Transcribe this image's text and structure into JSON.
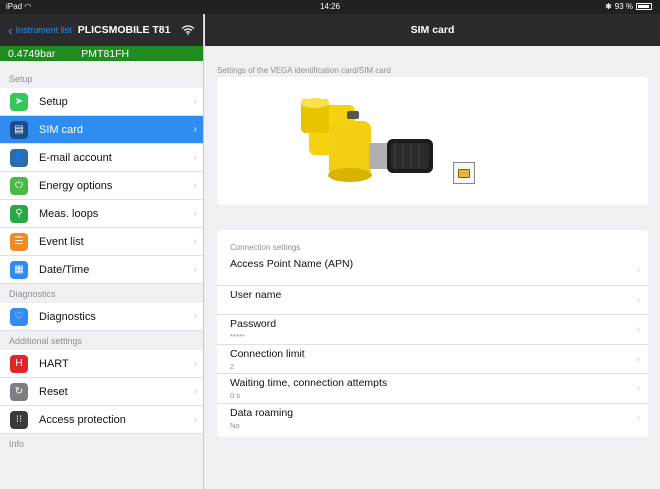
{
  "status": {
    "carrier": "iPad",
    "time": "14:26",
    "battery": "93 %",
    "battery_level": 0.93
  },
  "left": {
    "back_label": "Instrument list",
    "instrument_name": "PLICSMOBILE T81",
    "measured_value": "0.4749bar",
    "tag": "PMT81FH",
    "sections": [
      {
        "title": "Setup",
        "items": [
          {
            "label": "Setup",
            "icon": "paper-plane-icon",
            "color": "#34c759"
          },
          {
            "label": "SIM card",
            "icon": "sim-card-icon",
            "color": "#1c4f8a",
            "selected": true
          },
          {
            "label": "E-mail account",
            "icon": "user-icon",
            "color": "#2d6ca8"
          },
          {
            "label": "Energy options",
            "icon": "energy-icon",
            "color": "#4cb848"
          },
          {
            "label": "Meas. loops",
            "icon": "location-icon",
            "color": "#28a745"
          },
          {
            "label": "Event list",
            "icon": "event-list-icon",
            "color": "#f08a24"
          },
          {
            "label": "Date/Time",
            "icon": "calendar-icon",
            "color": "#2f8cf0"
          }
        ]
      },
      {
        "title": "Diagnostics",
        "items": [
          {
            "label": "Diagnostics",
            "icon": "stethoscope-icon",
            "color": "#2f8cf0"
          }
        ]
      },
      {
        "title": "Additional settings",
        "items": [
          {
            "label": "HART",
            "icon": "hart-icon",
            "color": "#e0262b"
          },
          {
            "label": "Reset",
            "icon": "reset-icon",
            "color": "#7d7d82"
          },
          {
            "label": "Access protection",
            "icon": "keypad-icon",
            "color": "#3a3a3c"
          }
        ]
      },
      {
        "title": "Info",
        "items": []
      }
    ]
  },
  "right": {
    "title": "SIM card",
    "image_caption": "Settings of the VEGA identification card/SIM card",
    "settings_title": "Connection settings",
    "rows": [
      {
        "label": "Access Point Name (APN)",
        "value": ""
      },
      {
        "label": "User name",
        "value": ""
      },
      {
        "label": "Password",
        "value": "*****"
      },
      {
        "label": "Connection limit",
        "value": "2"
      },
      {
        "label": "Waiting time, connection attempts",
        "value": "0 s"
      },
      {
        "label": "Data roaming",
        "value": "No"
      }
    ]
  }
}
